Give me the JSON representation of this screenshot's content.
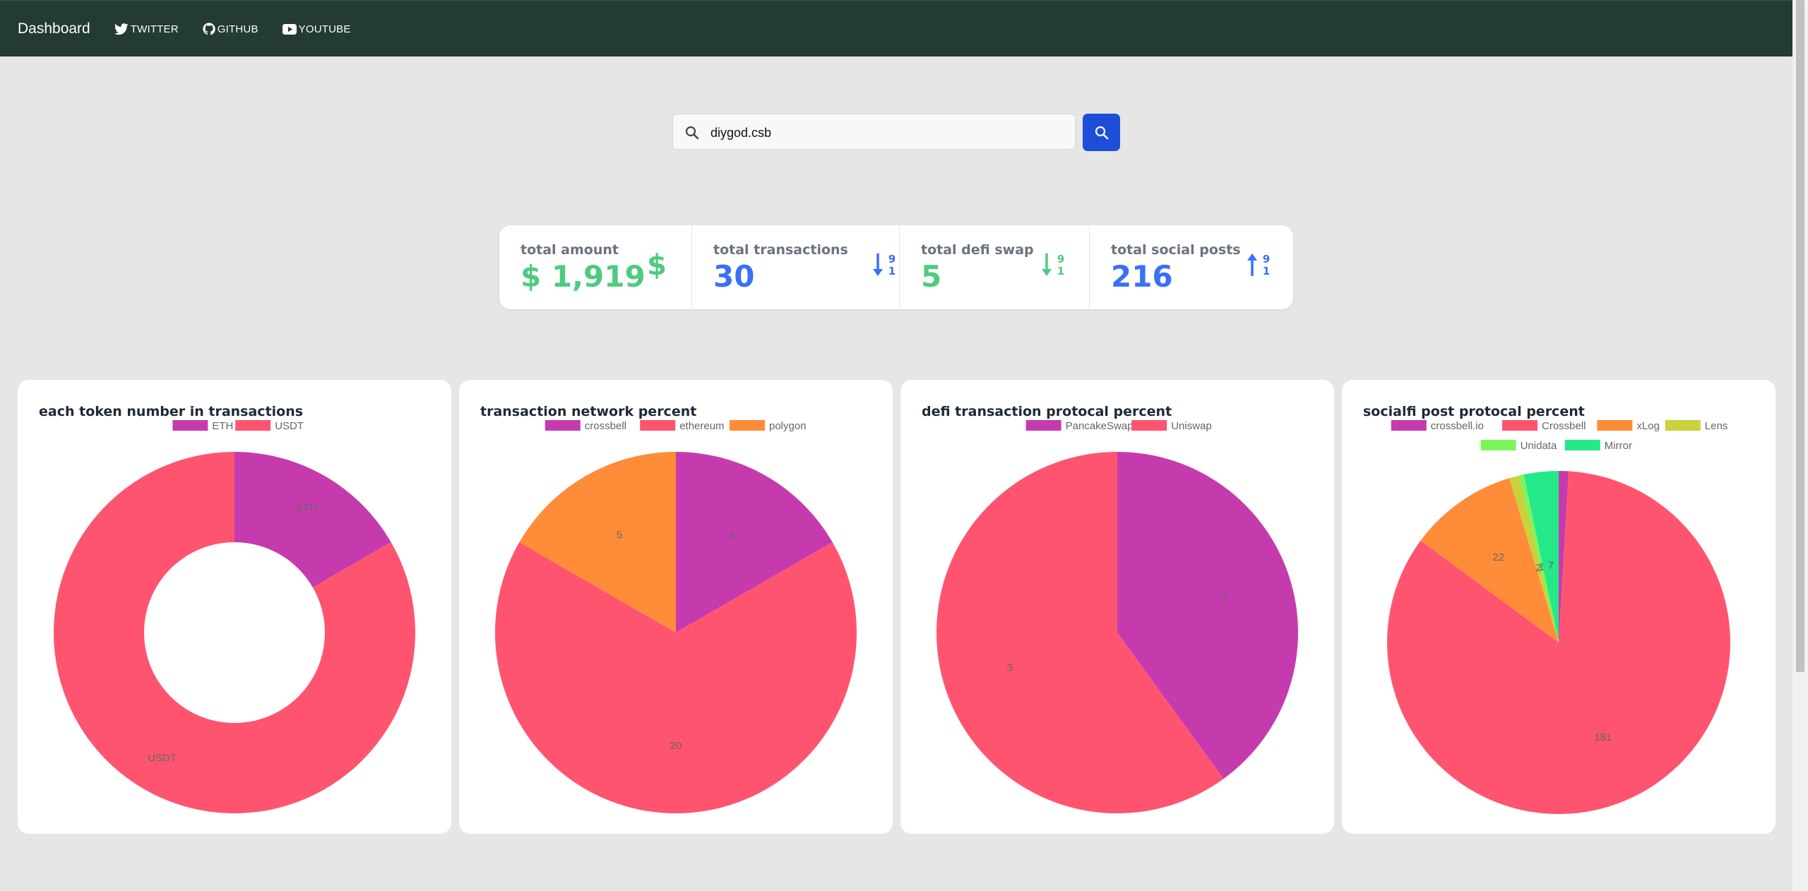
{
  "navbar": {
    "brand": "Dashboard",
    "links": [
      {
        "label": "TWITTER",
        "icon": "twitter-icon"
      },
      {
        "label": "GITHUB",
        "icon": "github-icon"
      },
      {
        "label": "YOUTUBE",
        "icon": "youtube-icon"
      }
    ],
    "background_color": "#233b31"
  },
  "search": {
    "value": "diygod.csb",
    "button_color": "#1d4ed8"
  },
  "stats": [
    {
      "title": "total amount",
      "value": "$ 1,919",
      "color": "#4ecb81",
      "icon": "dollar-icon"
    },
    {
      "title": "total transactions",
      "value": "30",
      "color": "#3b6ff5",
      "icon": "sort-numeric-down-icon"
    },
    {
      "title": "total defi swap",
      "value": "5",
      "color": "#4ecb81",
      "icon": "sort-numeric-down-icon"
    },
    {
      "title": "total social posts",
      "value": "216",
      "color": "#3b6ff5",
      "icon": "sort-numeric-up-icon"
    }
  ],
  "chart_data": [
    {
      "type": "pie",
      "variant": "doughnut",
      "title": "each token number in transactions",
      "categories": [
        "ETH",
        "USDT"
      ],
      "values": [
        4,
        20
      ],
      "slice_labels": [
        "ETH",
        "USDT"
      ],
      "colors": [
        "#c53bae",
        "#ff5470"
      ],
      "legend": "top"
    },
    {
      "type": "pie",
      "title": "transaction network percent",
      "categories": [
        "crossbell",
        "ethereum",
        "polygon"
      ],
      "values": [
        5,
        20,
        5
      ],
      "slice_labels": [
        "5",
        "20",
        "5"
      ],
      "colors": [
        "#c53bae",
        "#ff5470",
        "#ff8c38"
      ],
      "legend": "top"
    },
    {
      "type": "pie",
      "title": "defi transaction protocal percent",
      "categories": [
        "PancakeSwap",
        "Uniswap"
      ],
      "values": [
        2,
        3
      ],
      "slice_labels": [
        "2",
        "3"
      ],
      "colors": [
        "#c53bae",
        "#ff5470"
      ],
      "legend": "top"
    },
    {
      "type": "pie",
      "title": "socialfi post protocal percent",
      "categories": [
        "crossbell.io",
        "Crossbell",
        "xLog",
        "Lens",
        "Unidata",
        "Mirror"
      ],
      "values": [
        2,
        181,
        22,
        2,
        1,
        7
      ],
      "slice_labels": [
        "",
        "181",
        "22",
        "2",
        "1",
        "7"
      ],
      "colors": [
        "#c53bae",
        "#ff5470",
        "#ff8c38",
        "#c9d23a",
        "#7cf55b",
        "#25e889"
      ],
      "legend": "top"
    }
  ]
}
